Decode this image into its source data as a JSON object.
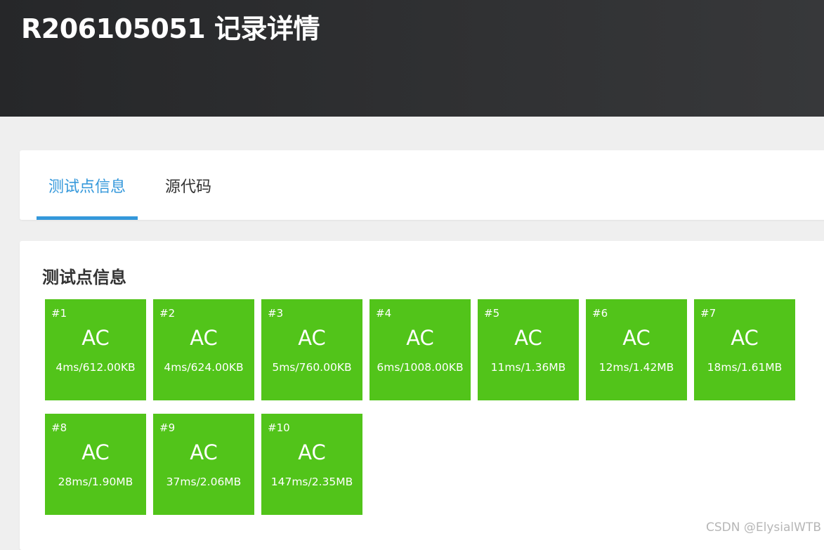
{
  "header": {
    "title": "R206105051 记录详情"
  },
  "tabs": [
    {
      "label": "测试点信息",
      "active": true
    },
    {
      "label": "源代码",
      "active": false
    }
  ],
  "section": {
    "title": "测试点信息"
  },
  "accent_color": "#3498db",
  "status_color": "#52c41a",
  "test_cases": [
    {
      "id": "#1",
      "status": "AC",
      "meta": "4ms/612.00KB"
    },
    {
      "id": "#2",
      "status": "AC",
      "meta": "4ms/624.00KB"
    },
    {
      "id": "#3",
      "status": "AC",
      "meta": "5ms/760.00KB"
    },
    {
      "id": "#4",
      "status": "AC",
      "meta": "6ms/1008.00KB"
    },
    {
      "id": "#5",
      "status": "AC",
      "meta": "11ms/1.36MB"
    },
    {
      "id": "#6",
      "status": "AC",
      "meta": "12ms/1.42MB"
    },
    {
      "id": "#7",
      "status": "AC",
      "meta": "18ms/1.61MB"
    },
    {
      "id": "#8",
      "status": "AC",
      "meta": "28ms/1.90MB"
    },
    {
      "id": "#9",
      "status": "AC",
      "meta": "37ms/2.06MB"
    },
    {
      "id": "#10",
      "status": "AC",
      "meta": "147ms/2.35MB"
    }
  ],
  "watermark": "CSDN @ElysialWTB"
}
